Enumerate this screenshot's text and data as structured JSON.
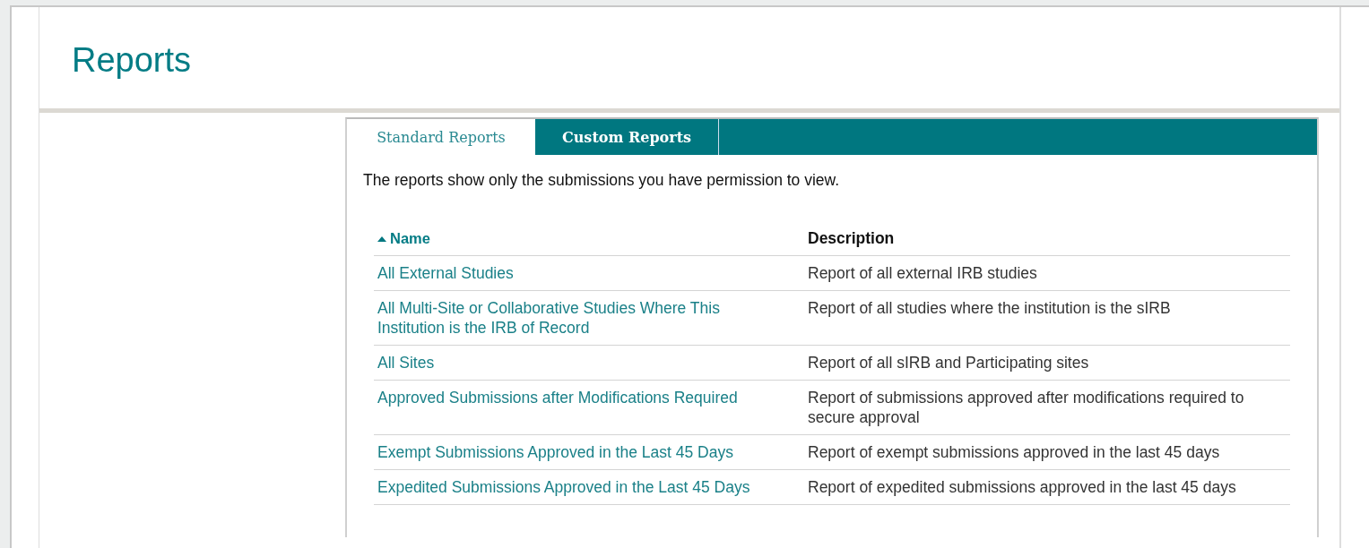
{
  "page": {
    "title": "Reports"
  },
  "tabs": [
    {
      "label": "Standard Reports",
      "selected": true
    },
    {
      "label": "Custom Reports",
      "selected": false
    }
  ],
  "notice": "The reports show only the submissions you have permission to view.",
  "table": {
    "columns": [
      {
        "label": "Name",
        "sortable": true
      },
      {
        "label": "Description",
        "sortable": false
      }
    ],
    "rows": [
      {
        "name": "All External Studies",
        "description": "Report of all external IRB studies"
      },
      {
        "name": "All Multi-Site or Collaborative Studies Where This Institution is the IRB of Record",
        "description": "Report of all studies where the institution is the sIRB"
      },
      {
        "name": "All Sites",
        "description": "Report of all sIRB and Participating sites"
      },
      {
        "name": "Approved Submissions after Modifications Required",
        "description": "Report of submissions approved after modifications required to secure approval"
      },
      {
        "name": "Exempt Submissions Approved in the Last 45 Days",
        "description": "Report of exempt submissions approved in the last 45 days"
      },
      {
        "name": "Expedited Submissions Approved in the Last 45 Days",
        "description": "Report of expedited submissions approved in the last 45 days"
      }
    ]
  }
}
